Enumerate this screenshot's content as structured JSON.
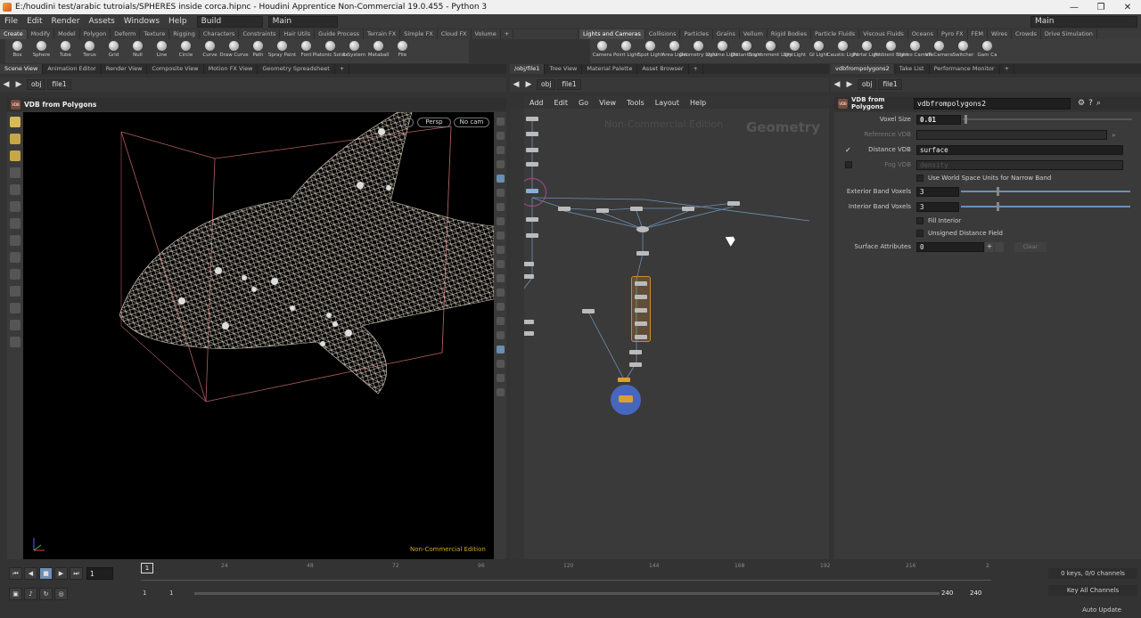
{
  "window": {
    "title": "E:/houdini test/arabic tutroials/SPHERES inside corca.hipnc - Houdini Apprentice Non-Commercial 19.0.455 - Python 3",
    "min": "—",
    "max": "❐",
    "close": "✕"
  },
  "menu": {
    "items": [
      "File",
      "Edit",
      "Render",
      "Assets",
      "Windows",
      "Help"
    ],
    "build": "Build",
    "main": "Main",
    "desktop": "Main"
  },
  "shelf_left": {
    "tabs": [
      "Create",
      "Modify",
      "Model",
      "Polygon",
      "Deform",
      "Texture",
      "Rigging",
      "Characters",
      "Constraints",
      "Hair Utils",
      "Guide Process",
      "Terrain FX",
      "Simple FX",
      "Cloud FX",
      "Volume"
    ],
    "tools": [
      "Box",
      "Sphere",
      "Tube",
      "Torus",
      "Grid",
      "Null",
      "Line",
      "Circle",
      "Curve",
      "Draw Curve",
      "Path",
      "Spray Paint",
      "Font",
      "Platonic Solids",
      "L-System",
      "Metaball",
      "File"
    ]
  },
  "shelf_right": {
    "tabs": [
      "Lights and Cameras",
      "Collisions",
      "Particles",
      "Grains",
      "Vellum",
      "Rigid Bodies",
      "Particle Fluids",
      "Viscous Fluids",
      "Oceans",
      "Pyro FX",
      "FEM",
      "Wires",
      "Crowds",
      "Drive Simulation"
    ],
    "tools": [
      "Camera",
      "Point Light",
      "Spot Light",
      "Area Light",
      "Geometry Light",
      "Volume Light",
      "Distant Light",
      "Environment Light",
      "Sky Light",
      "GI Light",
      "Caustic Light",
      "Portal Light",
      "Ambient Light",
      "Stereo Camera",
      "VR Camera",
      "Switcher",
      "Gam Ca"
    ]
  },
  "left_pane": {
    "tabs": [
      "Scene View",
      "Animation Editor",
      "Render View",
      "Composite View",
      "Motion FX View",
      "Geometry Spreadsheet"
    ],
    "path_obj": "obj",
    "path_file": "file1",
    "op_title": "VDB from Polygons",
    "persp": "Persp",
    "nocam": "No cam",
    "watermark": "Non-Commercial Edition"
  },
  "network_pane": {
    "tabs": [
      "/obj/file1",
      "Tree View",
      "Material Palette",
      "Asset Browser"
    ],
    "path_obj": "obj",
    "path_file": "file1",
    "menu": [
      "Add",
      "Edit",
      "Go",
      "View",
      "Tools",
      "Layout",
      "Help"
    ],
    "watermark": "Non-Commercial Edition",
    "context": "Geometry"
  },
  "param_pane": {
    "tabs": [
      "vdbfrompolygons2",
      "Take List",
      "Performance Monitor"
    ],
    "path_obj": "obj",
    "path_file": "file1",
    "op_type": "VDB from Polygons",
    "op_name": "vdbfrompolygons2",
    "voxel_size_label": "Voxel Size",
    "voxel_size": "0.01",
    "reference_vdb_label": "Reference VDB",
    "distance_vdb_label": "Distance VDB",
    "distance_vdb": "surface",
    "distance_checked": "✓",
    "fog_vdb_label": "Fog VDB",
    "fog_vdb": "density",
    "world_space_label": "Use World Space Units for Narrow Band",
    "ext_band_label": "Exterior Band Voxels",
    "ext_band": "3",
    "int_band_label": "Interior Band Voxels",
    "int_band": "3",
    "fill_interior_label": "Fill Interior",
    "unsigned_label": "Unsigned Distance Field",
    "surface_attr_label": "Surface Attributes",
    "surface_attr": "0",
    "clear": "Clear"
  },
  "timeline": {
    "ticks": [
      "1",
      "24",
      "48",
      "72",
      "96",
      "120",
      "144",
      "168",
      "192",
      "216",
      "2"
    ],
    "frame": "1",
    "range_start": "1",
    "range_start2": "1",
    "range_end": "240",
    "range_end2": "240",
    "keys": "0 keys, 0/0 channels",
    "key_all": "Key All Channels",
    "auto_update": "Auto Update"
  }
}
